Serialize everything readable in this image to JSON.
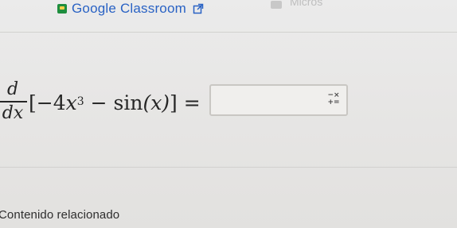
{
  "header": {
    "link_label": "Google Classroom",
    "link_icon": "google-classroom-icon",
    "external_icon": "external-link-icon",
    "faint_right_text": "Micros"
  },
  "problem": {
    "numerator": "d",
    "denominator": "dx",
    "open_bracket": "[",
    "coefficient": "−4",
    "variable": "x",
    "exponent": "3",
    "operator": " − ",
    "function": "sin",
    "argument": "(x)",
    "close_bracket": "]",
    "equals": " = "
  },
  "answer": {
    "value": "",
    "keyboard_icon": "math-keypad-icon",
    "keypad_top": "−×",
    "keypad_bottom": "+="
  },
  "footer": {
    "related_heading": "Contenido relacionado"
  },
  "colors": {
    "link": "#2962c4",
    "classroom_green": "#1e8e3e",
    "classroom_yellow": "#fbd04b",
    "background": "#e8e7e5"
  }
}
